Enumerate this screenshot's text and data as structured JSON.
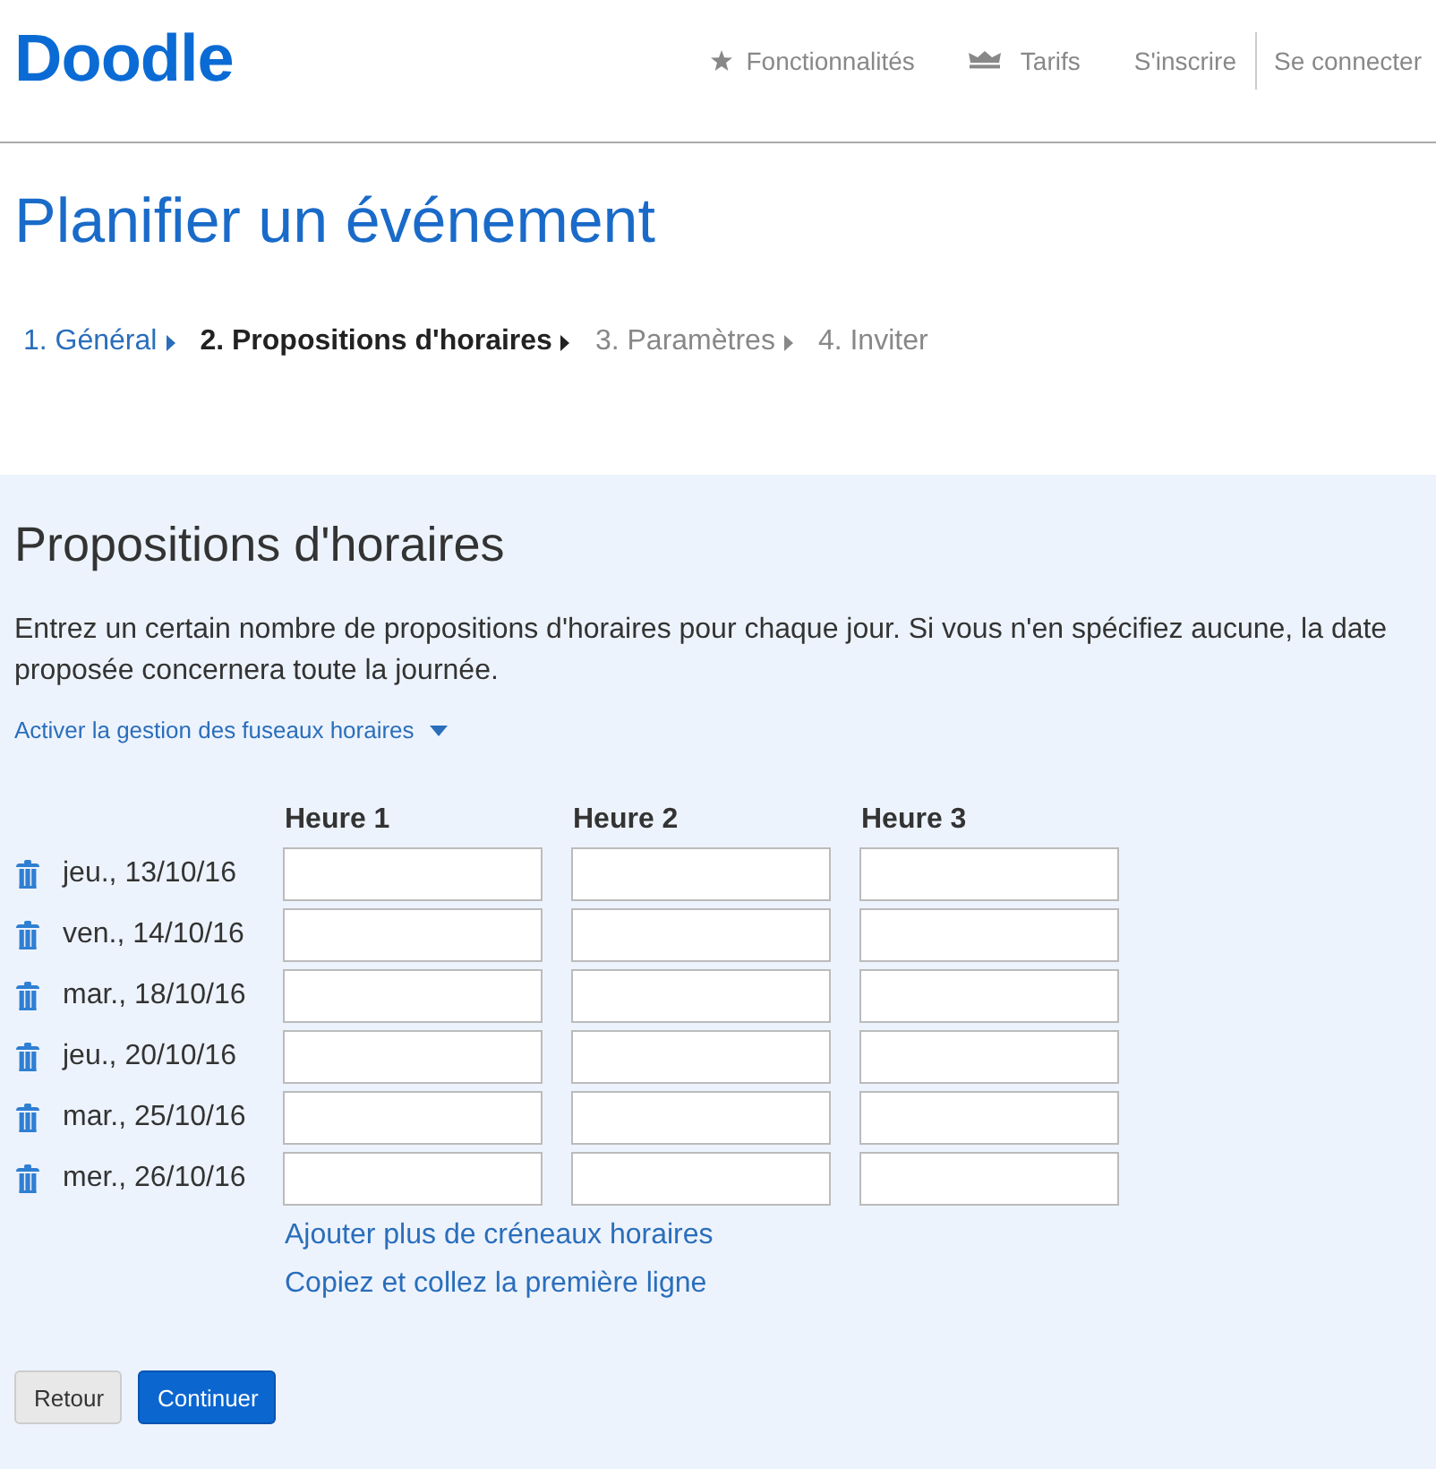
{
  "header": {
    "logo": "Doodle",
    "nav": [
      {
        "kind": "star",
        "label": "Fonctionnalités",
        "separated": false
      },
      {
        "kind": "crown",
        "label": "Tarifs",
        "separated": false
      },
      {
        "kind": "text",
        "label": "S'inscrire",
        "separated": false
      },
      {
        "kind": "text",
        "label": "Se connecter",
        "separated": true
      }
    ]
  },
  "page_title": "Planifier un événement",
  "steps": [
    {
      "label": "1. Général",
      "selected": false,
      "completed": true
    },
    {
      "label": "2. Propositions d'horaires",
      "selected": true,
      "completed": false
    },
    {
      "label": "3. Paramètres",
      "selected": false,
      "completed": false
    },
    {
      "label": "4. Inviter",
      "selected": false,
      "completed": false
    }
  ],
  "time_slots": {
    "title": "Propositions d'horaires",
    "description": "Entrez un certain nombre de propositions d'horaires pour chaque jour. Si vous n'en spécifiez aucune, la date proposée concernera toute la journée.",
    "timezone_toggle": {
      "label": "Activer la gestion des fuseaux horaires",
      "expanded": false
    },
    "columns": [
      "Heure 1",
      "Heure 2",
      "Heure 3"
    ],
    "rows": [
      {
        "date": "jeu., 13/10/16"
      },
      {
        "date": "ven., 14/10/16"
      },
      {
        "date": "mar., 18/10/16"
      },
      {
        "date": "jeu., 20/10/16"
      },
      {
        "date": "mar., 25/10/16"
      },
      {
        "date": "mer., 26/10/16"
      }
    ],
    "links": [
      "Ajouter plus de créneaux horaires",
      "Copiez et collez la première ligne"
    ]
  },
  "buttons": [
    {
      "label": "Retour",
      "kind": "secondary"
    },
    {
      "label": "Continuer",
      "kind": "primary"
    }
  ]
}
